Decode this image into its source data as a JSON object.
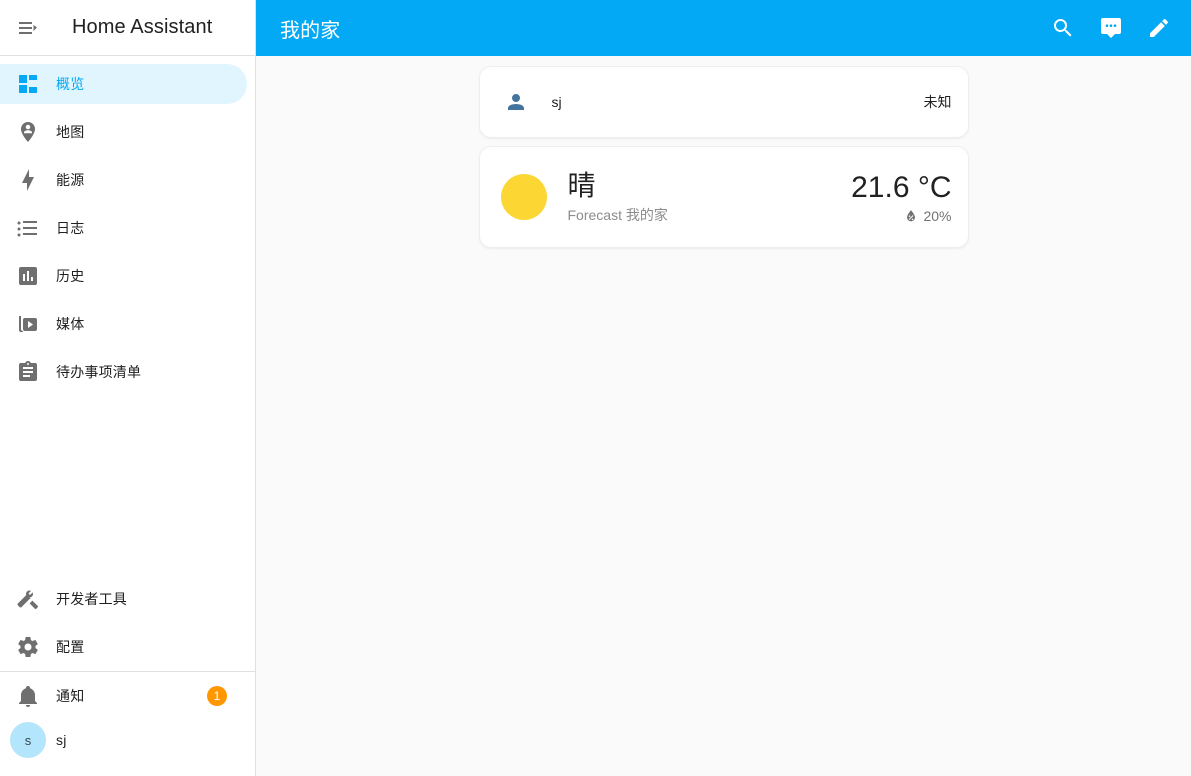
{
  "sidebar": {
    "menu_icon": "menu-open-icon",
    "title": "Home Assistant",
    "items": [
      {
        "label": "概览",
        "icon": "view-dashboard-icon",
        "active": true
      },
      {
        "label": "地图",
        "icon": "map-marker-account-icon",
        "active": false
      },
      {
        "label": "能源",
        "icon": "lightning-bolt-icon",
        "active": false
      },
      {
        "label": "日志",
        "icon": "format-list-bulleted-icon",
        "active": false
      },
      {
        "label": "历史",
        "icon": "chart-box-icon",
        "active": false
      },
      {
        "label": "媒体",
        "icon": "play-box-multiple-icon",
        "active": false
      },
      {
        "label": "待办事项清单",
        "icon": "clipboard-list-icon",
        "active": false
      }
    ],
    "bottom_items": [
      {
        "label": "开发者工具",
        "icon": "hammer-wrench-icon"
      },
      {
        "label": "配置",
        "icon": "cog-icon"
      }
    ],
    "notifications": {
      "label": "通知",
      "icon": "bell-icon",
      "badge": "1",
      "badge_color": "#ff9800"
    },
    "user": {
      "label": "sj",
      "avatar_initial": "s",
      "avatar_color": "#b3e5fc"
    },
    "accent_color": "#03a9f4",
    "active_bg_color": "#e1f5fe"
  },
  "topbar": {
    "title": "我的家",
    "background_color": "#03a9f4",
    "actions": [
      {
        "name": "search-icon",
        "label": "搜索"
      },
      {
        "name": "assist-icon",
        "label": "Assist"
      },
      {
        "name": "pencil-icon",
        "label": "编辑"
      }
    ]
  },
  "main": {
    "entities_card": {
      "rows": [
        {
          "icon": "account-icon",
          "name": "sj",
          "state": "未知"
        }
      ]
    },
    "weather_card": {
      "icon": "weather-sunny-icon",
      "icon_color": "#fcd734",
      "state": "晴",
      "subtitle": "Forecast 我的家",
      "temperature": "21.6 °C",
      "humidity_icon": "water-percent-icon",
      "humidity": "20%"
    }
  }
}
